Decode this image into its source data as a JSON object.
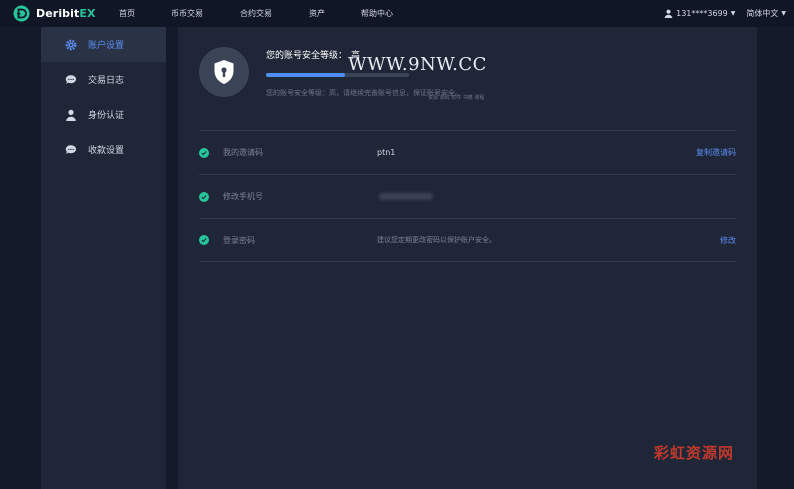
{
  "header": {
    "brand": {
      "main": "Deribit",
      "suffix": "EX"
    },
    "nav": [
      "首页",
      "币币交易",
      "合约交易",
      "资产",
      "帮助中心"
    ],
    "user": "131****3699",
    "language": "简体中文"
  },
  "sidebar": {
    "items": [
      {
        "label": "账户设置",
        "icon": "gear-icon",
        "active": true
      },
      {
        "label": "交易日志",
        "icon": "chat-icon",
        "active": false
      },
      {
        "label": "身份认证",
        "icon": "person-icon",
        "active": false
      },
      {
        "label": "收款设置",
        "icon": "chat-icon",
        "active": false
      }
    ]
  },
  "security": {
    "title": "您的账号安全等级：",
    "level": "高",
    "progress": 0.55,
    "description": "您的账号安全等级：高，请继续完善账号信息，保证账号安全。"
  },
  "watermark": {
    "text": "WWW.9NW.CC",
    "sub": "资源 源码 软件 书籍 课程"
  },
  "settings": [
    {
      "label": "我的邀请码",
      "value": "ptn1",
      "action": "复制邀请码"
    },
    {
      "label": "修改手机号",
      "value": "",
      "action": ""
    },
    {
      "label": "登录密码",
      "value": "建议您定期更改密码以保护账户安全。",
      "action": "修改"
    }
  ],
  "corner_watermark": "彩虹资源网",
  "colors": {
    "accent": "#5c8ef2",
    "success": "#27c59a",
    "brand": "#27c59a"
  }
}
